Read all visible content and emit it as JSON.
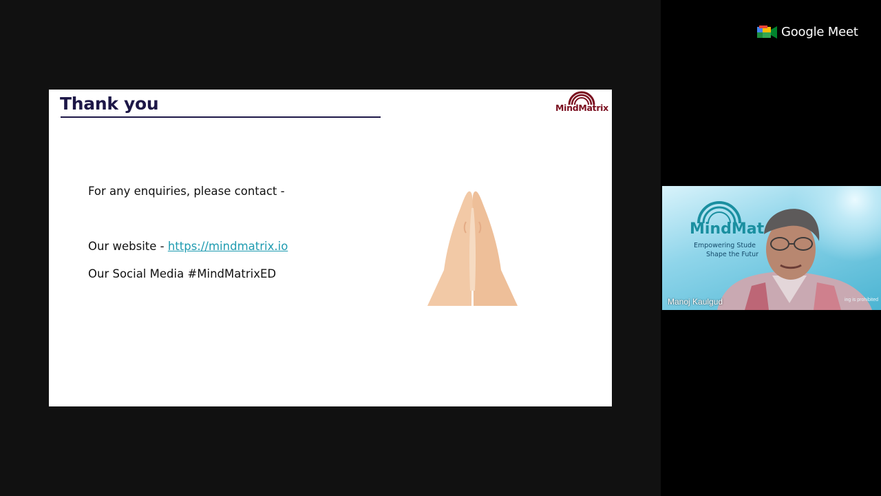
{
  "app": {
    "brand_name": "Google Meet"
  },
  "slide": {
    "title": "Thank you",
    "logo_text": "MindMatrix",
    "enquiries_text": "For any enquiries, please contact -",
    "website_prefix": "Our website - ",
    "website_link": "https://mindmatrix.io",
    "social_text": "Our Social Media #MindMatrixED"
  },
  "participant": {
    "name": "Manoj Kaulgud",
    "background_brand": "MindMat",
    "background_tagline_1": "Empowering Stude",
    "background_tagline_2": "Shape the Futur",
    "background_notice": "ing is prohibited"
  },
  "colors": {
    "title": "#1d1747",
    "link": "#1e9bb0",
    "logo": "#7a0d1e",
    "stage": "#111111"
  }
}
